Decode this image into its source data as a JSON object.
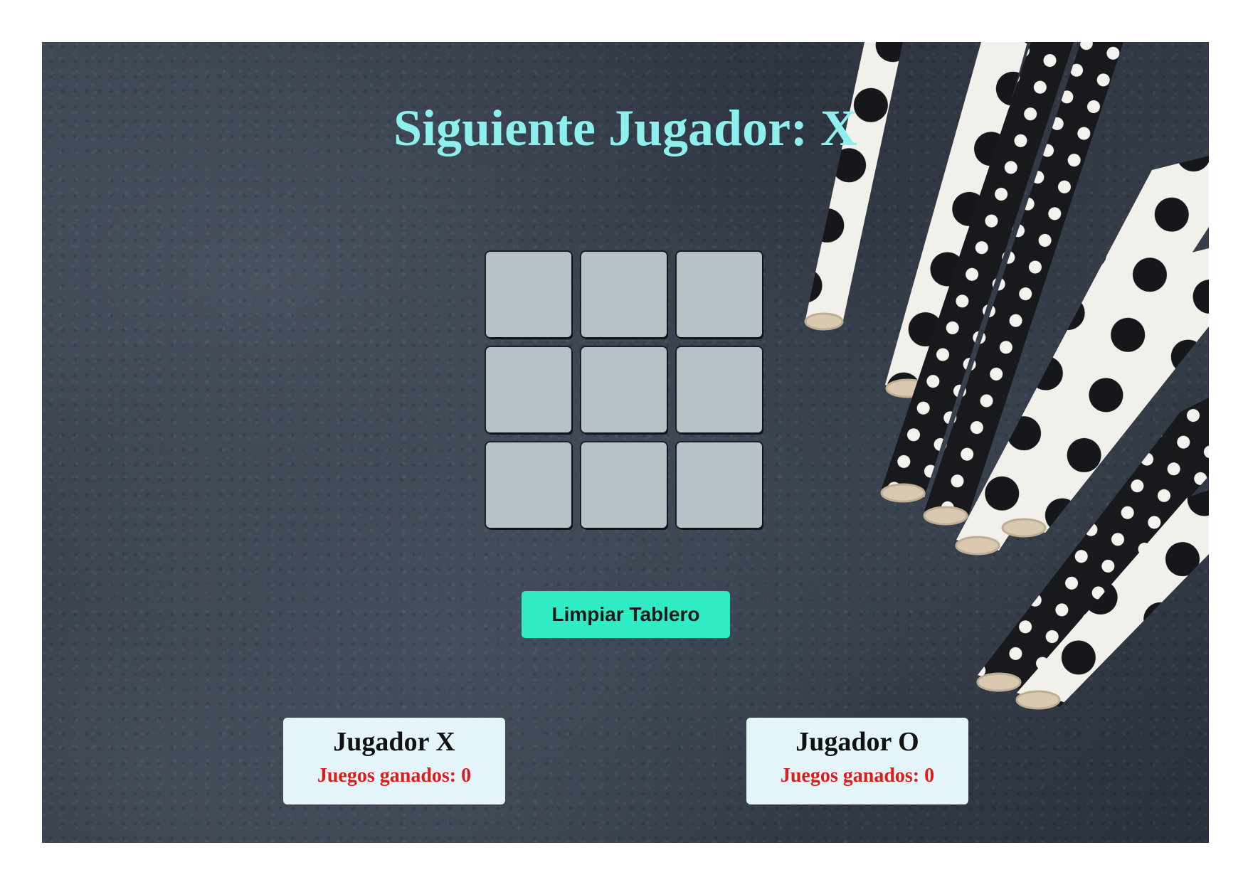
{
  "status": {
    "label": "Siguiente Jugador: X"
  },
  "board": {
    "cells": [
      "",
      "",
      "",
      "",
      "",
      "",
      "",
      "",
      ""
    ]
  },
  "controls": {
    "reset_label": "Limpiar Tablero"
  },
  "scores": {
    "player_x": {
      "name": "Jugador X",
      "wins_label": "Juegos ganados: 0"
    },
    "player_o": {
      "name": "Jugador O",
      "wins_label": "Juegos ganados: 0"
    }
  },
  "colors": {
    "title": "#8ef0ee",
    "cell": "#b7c2c8",
    "reset_button": "#30ecc4",
    "score_card": "#e4f5f9",
    "wins_text": "#dd1c1c"
  }
}
